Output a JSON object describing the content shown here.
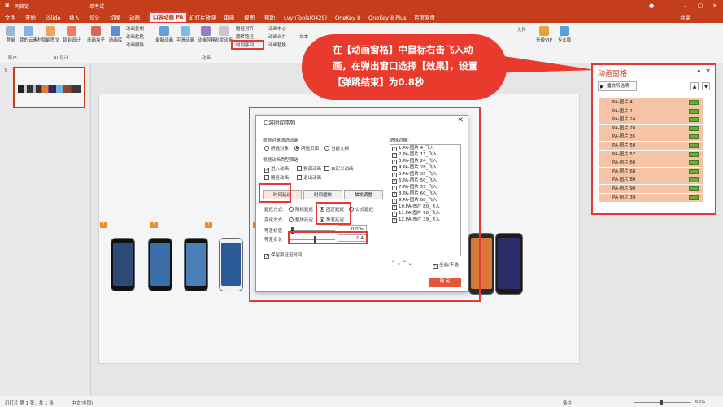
{
  "titlebar": {
    "save": "网络链",
    "mode": "单考试",
    "account": "登录"
  },
  "tabs": [
    "文件",
    "开始",
    "iSlide",
    "插入",
    "设计",
    "切换",
    "动画",
    "口袋动画 PA",
    "幻灯片放映",
    "审阅",
    "视图",
    "帮助",
    "LvyhTools(0429)",
    "OneKey 8",
    "OneKey 8 Plus",
    "百度网盘"
  ],
  "share": "共享",
  "ribbon": {
    "login": "登录",
    "cloud": "我的云素材",
    "smart_text": "智能图文",
    "smart_design": "智能设计",
    "anim_box": "动画盒子",
    "anim_lib": "动画库",
    "anim_copy": "动画复制",
    "anim_paste": "动画粘贴",
    "anim_delete": "动画删除",
    "record_anim": "录制动画",
    "smooth_anim": "平滑动画",
    "anim_style": "动画风格",
    "shape_anim": "形状动画",
    "path_align": "路径对齐",
    "path_reverse": "翻转路径",
    "path_lock": "路径锁定",
    "time_seq": "时间序列",
    "anim_center": "动画中心",
    "anim_merge": "动画合并",
    "anim_replace": "动画替换",
    "text": "文本",
    "upgrade_vip": "升级VIP",
    "pro": "专业版",
    "file_item": "文件",
    "grp_account": "账户",
    "grp_ai": "AI 设计",
    "grp_anim": "动画"
  },
  "slide_number": "1",
  "badges": [
    "1",
    "1",
    "1",
    "1"
  ],
  "dialog": {
    "title": "口袋时间序列",
    "filter_obj": "根据对象筛选动画",
    "opt_all": "所选对象",
    "opt_page": "所选页面",
    "opt_doc": "当前文档",
    "filter_type": "根据动画类型筛选",
    "t_enter": "进入动画",
    "t_emph": "强调动画",
    "t_custom": "自定义动画",
    "t_path": "路径动画",
    "t_exit": "退出动画",
    "tabs": [
      "时间延迟",
      "时间缩放",
      "触发调整"
    ],
    "delay_mode": "延迟方式:",
    "random_delay": "随机延迟",
    "fixed_delay": "固定延迟",
    "formula_delay": "公式延迟",
    "change_mode": "变化方式:",
    "whole_delay": "整体延迟",
    "step_delay": "等差延迟",
    "first_label": "等差初值",
    "first_value": "0.00s",
    "step_label": "等差步长",
    "step_value": "0.4",
    "keep_original": "保留原延迟时间",
    "select_label": "选择对象:",
    "objects": [
      "1.PA-图片 4_飞入",
      "2.PA-图片 11_飞入",
      "3.PA-图片 24_飞入",
      "4.PA-图片 28_飞入",
      "5.PA-图片 35_飞入",
      "6.PA-图片 50_飞入",
      "7.PA-图片 57_飞入",
      "8.PA-图片 60_飞入",
      "9.PA-图片 68_飞入",
      "10.PA-图片 80_飞入",
      "11.PA-图片 90_飞入",
      "12.PA-图片 39_飞入"
    ],
    "select_all": "全选/不选",
    "ok": "确 定"
  },
  "callout": "在【动画窗格】中鼠标右击飞入动画，在弹出窗口选择【效果】，设置【弹跳结束】为0.8秒",
  "anim_pane": {
    "title": "动画窗格",
    "play_btn": "播放所选项",
    "items": [
      "PA-图片 4",
      "PA-图片 11",
      "PA-图片 24",
      "PA-图片 28",
      "PA-图片 35",
      "PA-图片 50",
      "PA-图片 57",
      "PA-图片 60",
      "PA-图片 68",
      "PA-图片 80",
      "PA-图片 90",
      "PA-图片 39"
    ],
    "first_index": "1"
  },
  "status": {
    "slide": "幻灯片 第 1 张，共 1 张",
    "lang": "中文(中国)",
    "notes": "备注",
    "zoom": "63%"
  }
}
